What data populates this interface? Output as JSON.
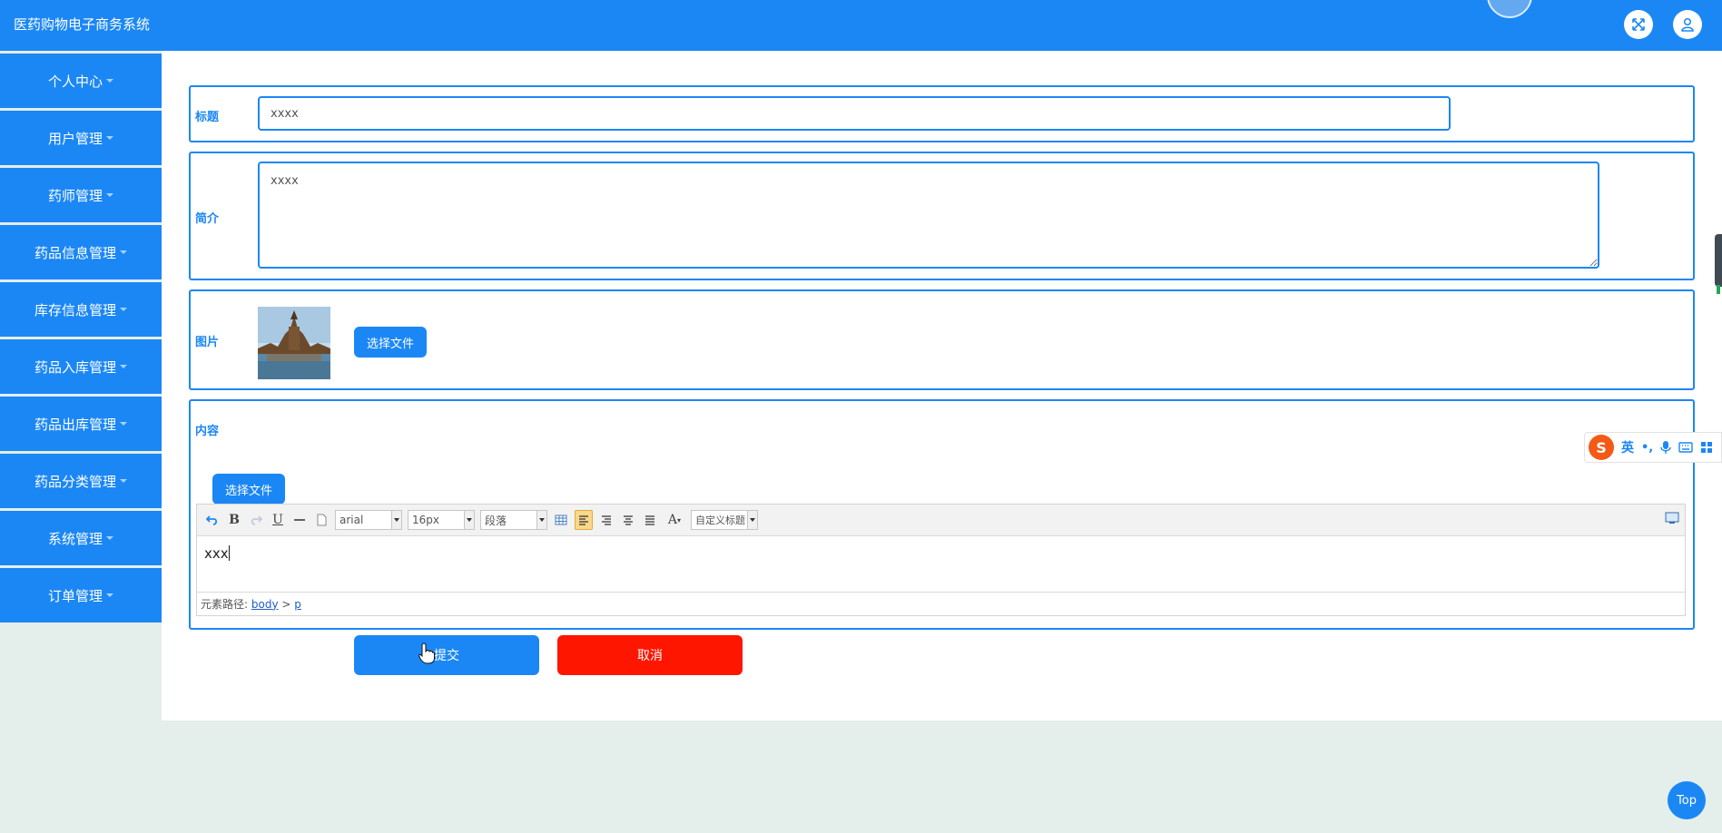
{
  "app": {
    "title": "医药购物电子商务系统"
  },
  "header": {
    "fullscreen_icon": "fullscreen-icon",
    "user_icon": "user-icon"
  },
  "sidebar": {
    "items": [
      {
        "label": "个人中心"
      },
      {
        "label": "用户管理"
      },
      {
        "label": "药师管理"
      },
      {
        "label": "药品信息管理"
      },
      {
        "label": "库存信息管理"
      },
      {
        "label": "药品入库管理"
      },
      {
        "label": "药品出库管理"
      },
      {
        "label": "药品分类管理"
      },
      {
        "label": "系统管理"
      },
      {
        "label": "订单管理"
      }
    ]
  },
  "form": {
    "title": {
      "label": "标题",
      "value": "xxxx"
    },
    "intro": {
      "label": "简介",
      "value": "xxxx"
    },
    "image": {
      "label": "图片",
      "upload_label": "选择文件"
    },
    "content": {
      "label": "内容",
      "upload_label": "选择文件",
      "toolbar": {
        "bold": "B",
        "underline": "U",
        "font_family": "arial",
        "font_size": "16px",
        "paragraph": "段落",
        "font_color": "A",
        "custom_heading": "自定义标题"
      },
      "body_text": "xxx",
      "path_label": "元素路径:",
      "path_body": "body",
      "path_sep": ">",
      "path_p": "p"
    },
    "submit_label": "提交",
    "cancel_label": "取消"
  },
  "ime": {
    "logo": "S",
    "lang": "英"
  },
  "back_to_top": "Top",
  "colors": {
    "primary": "#1b87f5",
    "danger": "#fe1600",
    "background": "#e4eeeb"
  }
}
